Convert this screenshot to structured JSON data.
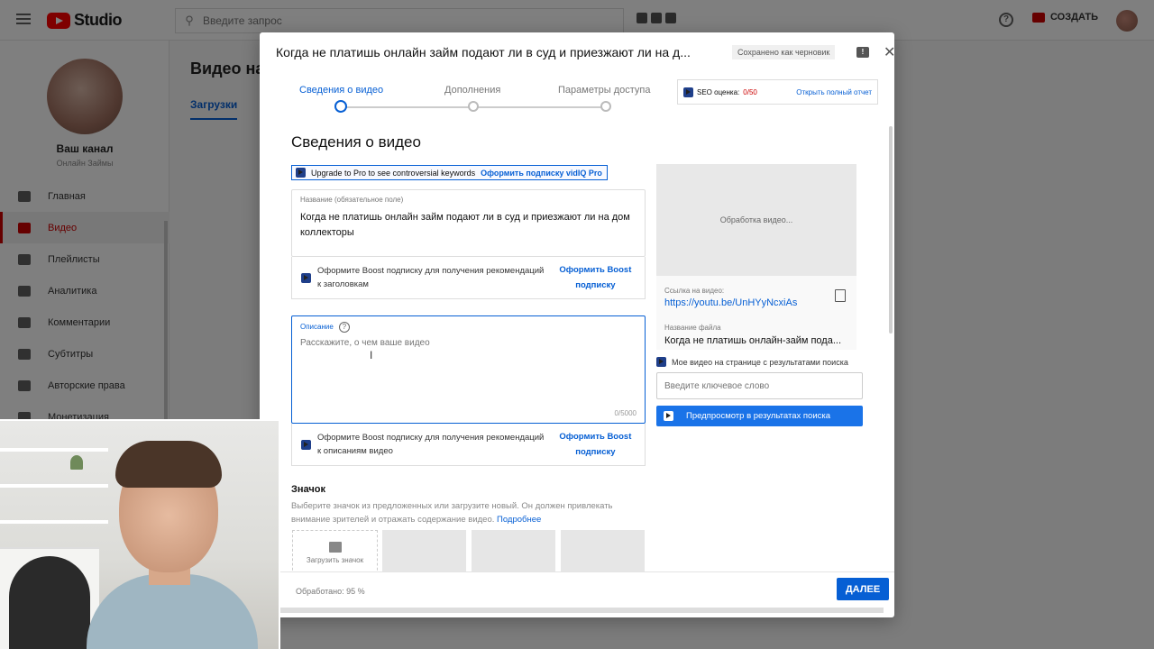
{
  "topbar": {
    "logo_text": "Studio",
    "search_placeholder": "Введите запрос",
    "create_label": "СОЗДАТЬ"
  },
  "sidebar": {
    "channel_title": "Ваш канал",
    "channel_subtitle": "Онлайн Займы",
    "items": [
      {
        "label": "Главная"
      },
      {
        "label": "Видео"
      },
      {
        "label": "Плейлисты"
      },
      {
        "label": "Аналитика"
      },
      {
        "label": "Комментарии"
      },
      {
        "label": "Субтитры"
      },
      {
        "label": "Авторские права"
      },
      {
        "label": "Монетизация"
      }
    ]
  },
  "background": {
    "heading": "Видео на",
    "tab": "Загрузки"
  },
  "dialog": {
    "title": "Когда не платишь онлайн займ подают ли в суд и приезжают ли на д...",
    "draft_status": "Сохранено как черновик",
    "steps": [
      "Сведения о видео",
      "Дополнения",
      "Параметры доступа"
    ],
    "seo": {
      "label": "SEO оценка:",
      "score": "0/50",
      "link": "Открыть полный отчет"
    },
    "section_title": "Сведения о видео",
    "upgrade": {
      "text": "Upgrade to Pro to see controversial keywords",
      "link": "Оформить подписку vidIQ Pro"
    },
    "title_field": {
      "label": "Название (обязательное поле)",
      "value": "Когда не платишь онлайн займ подают ли в суд и приезжают ли на дом коллекторы"
    },
    "boost_title": {
      "text": "Оформите Boost подписку для получения рекомендаций к заголовкам",
      "link": "Оформить Boost подписку"
    },
    "description_field": {
      "label": "Описание",
      "help": "?",
      "placeholder": "Расскажите, о чем ваше видео",
      "count": "0/5000"
    },
    "boost_desc": {
      "text": "Оформите Boost подписку для получения рекомендаций к описаниям видео",
      "link": "Оформить Boost подписку"
    },
    "preview": {
      "processing": "Обработка видео...",
      "link_label": "Ссылка на видео:",
      "link": "https://youtu.be/UnHYyNcxiAs",
      "file_label": "Название файла",
      "file_name": "Когда не платишь онлайн-займ пода..."
    },
    "search_preview": {
      "label": "Мое видео на странице с результатами поиска",
      "keyword_placeholder": "Введите ключевое слово",
      "button": "Предпросмотр в результатах поиска"
    },
    "thumbnail": {
      "title": "Значок",
      "description": "Выберите значок из предложенных или загрузите новый. Он должен привлекать внимание зрителей и отражать содержание видео.",
      "more": "Подробнее",
      "upload": "Загрузить значок"
    },
    "footer": {
      "processed": "Обработано: 95 %",
      "next": "ДАЛЕЕ"
    }
  },
  "colors": {
    "accent": "#065fd4",
    "brand": "#ff0000",
    "primary_button": "#1a73e8"
  }
}
